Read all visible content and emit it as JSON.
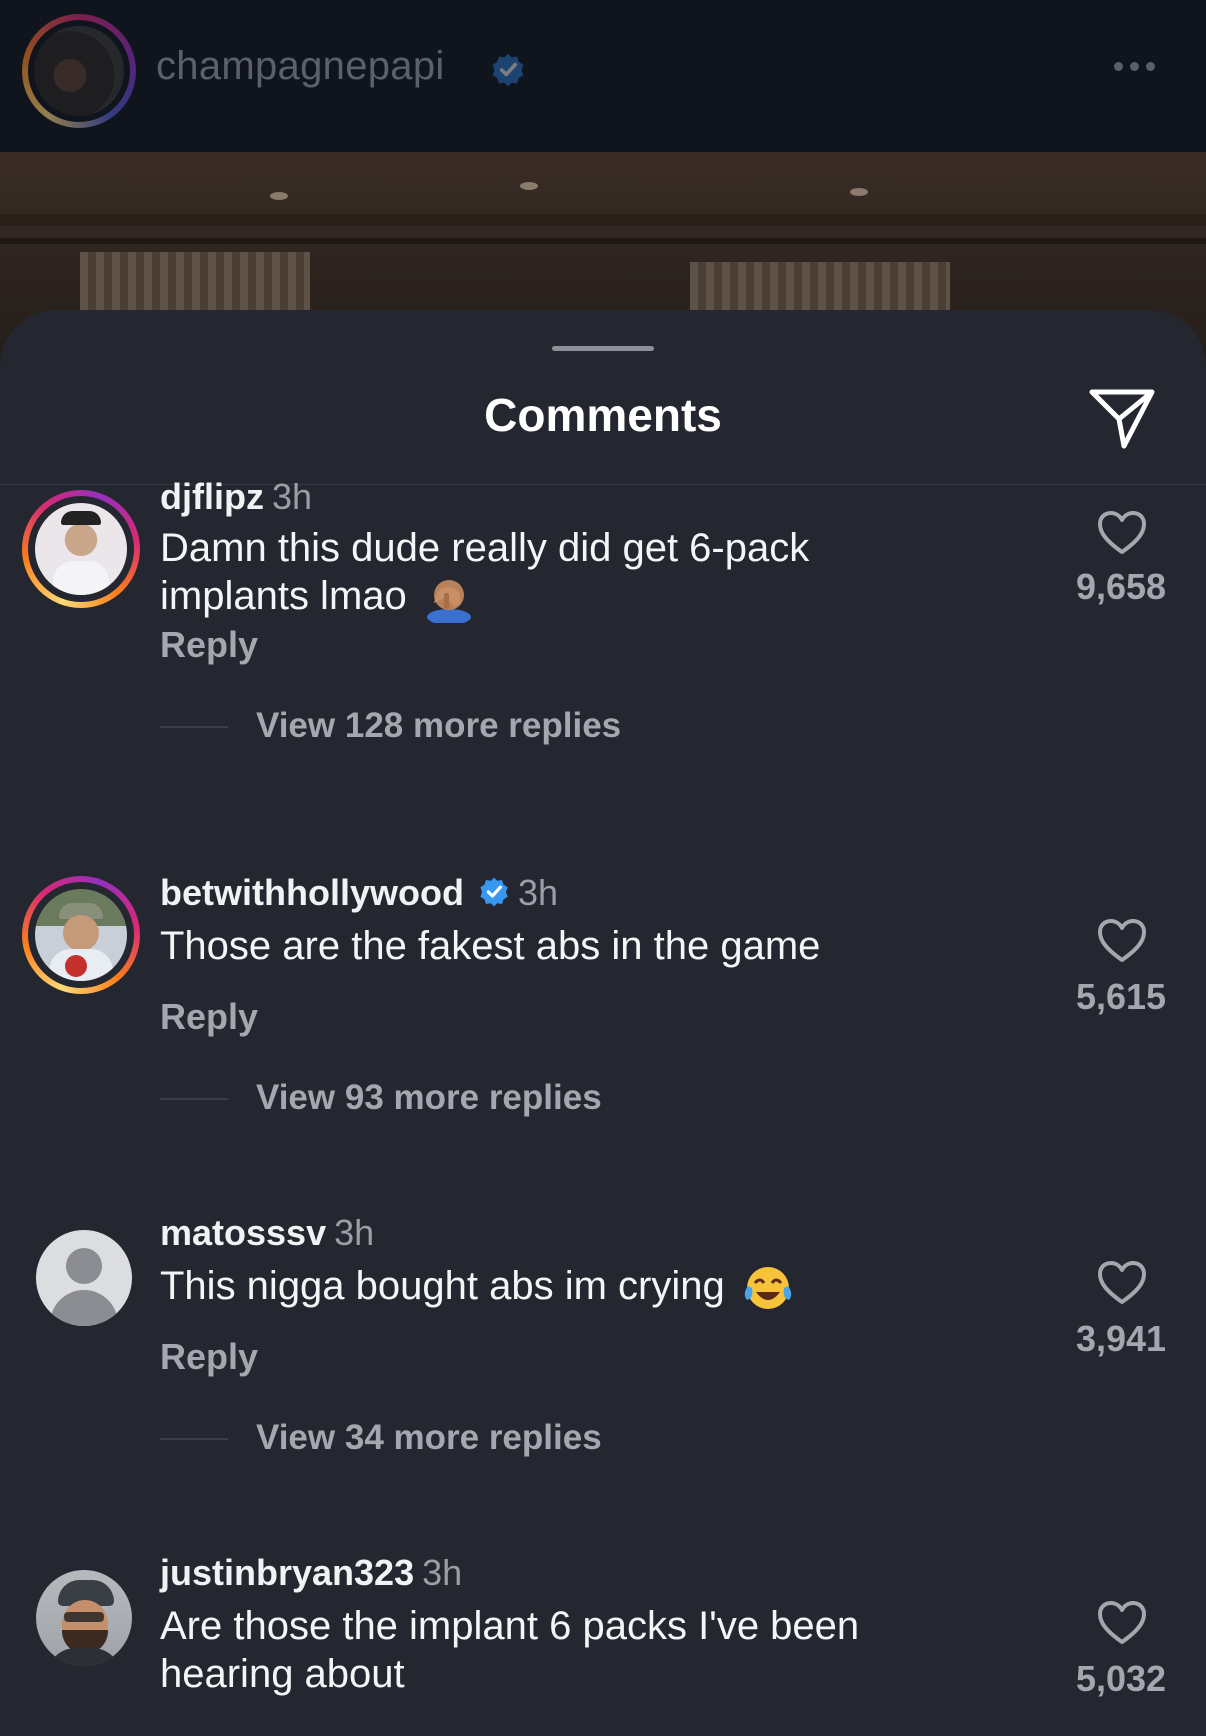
{
  "header": {
    "username": "champagnepapi",
    "avatar_icon": "profile-avatar",
    "verified_icon": "verified-badge-icon",
    "more_icon": "more-options-icon"
  },
  "sheet": {
    "title": "Comments",
    "share_icon": "send-icon"
  },
  "comments": [
    {
      "username": "djflipz",
      "verified": false,
      "time": "3h",
      "text": "Damn this dude really did get 6-pack implants lmao",
      "emoji": "facepalm-emoji",
      "reply_label": "Reply",
      "view_replies": "View 128 more replies",
      "likes": "9,658"
    },
    {
      "username": "betwithhollywood",
      "verified": true,
      "time": "3h",
      "text": "Those are the fakest abs in the game",
      "reply_label": "Reply",
      "view_replies": "View 93 more replies",
      "likes": "5,615"
    },
    {
      "username": "matosssv",
      "verified": false,
      "time": "3h",
      "text": "This nigga bought abs im crying",
      "emoji": "laughing-crying-emoji",
      "reply_label": "Reply",
      "view_replies": "View 34 more replies",
      "likes": "3,941"
    },
    {
      "username": "justinbryan323",
      "verified": false,
      "time": "3h",
      "text": "Are those the implant 6 packs I've been hearing about",
      "likes": "5,032"
    }
  ],
  "colors": {
    "sheet_bg": "#24272f",
    "header_bg": "#10141d",
    "verified_blue": "#3897f0",
    "secondary_text": "#a3a7af"
  }
}
